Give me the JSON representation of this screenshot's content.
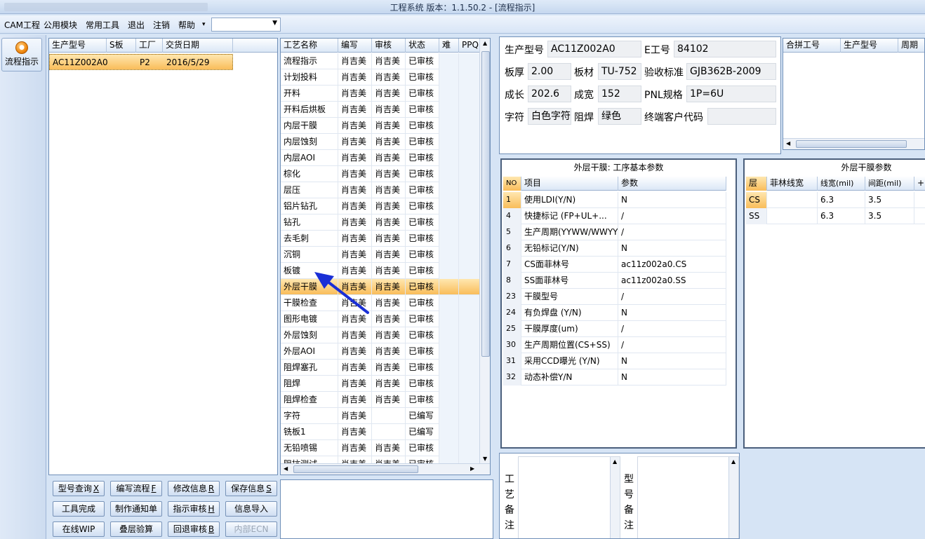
{
  "window": {
    "title": "工程系统   版本：1.1.50.2 - [流程指示]"
  },
  "menu": {
    "items": [
      "CAM工程",
      "公用模块",
      "常用工具",
      "退出",
      "注销",
      "帮助"
    ],
    "help_arrow": "▾",
    "combo_value": "",
    "combo_arrow": "▼"
  },
  "sidebar": {
    "flow_button": "流程指示"
  },
  "order_grid": {
    "headers": [
      "生产型号",
      "S板",
      "工厂",
      "交货日期"
    ],
    "rows": [
      [
        "AC11Z002A0",
        "",
        "P2",
        "2016/5/29"
      ]
    ]
  },
  "process_grid": {
    "headers": [
      "工艺名称",
      "编写",
      "审核",
      "状态",
      "难",
      "PPQI"
    ],
    "rows": [
      [
        "流程指示",
        "肖吉美",
        "肖吉美",
        "已审核"
      ],
      [
        "计划投料",
        "肖吉美",
        "肖吉美",
        "已审核"
      ],
      [
        "开料",
        "肖吉美",
        "肖吉美",
        "已审核"
      ],
      [
        "开料后烘板",
        "肖吉美",
        "肖吉美",
        "已审核"
      ],
      [
        "内层干膜",
        "肖吉美",
        "肖吉美",
        "已审核"
      ],
      [
        "内层蚀刻",
        "肖吉美",
        "肖吉美",
        "已审核"
      ],
      [
        "内层AOI",
        "肖吉美",
        "肖吉美",
        "已审核"
      ],
      [
        "棕化",
        "肖吉美",
        "肖吉美",
        "已审核"
      ],
      [
        "层压",
        "肖吉美",
        "肖吉美",
        "已审核"
      ],
      [
        "铝片钻孔",
        "肖吉美",
        "肖吉美",
        "已审核"
      ],
      [
        "钻孔",
        "肖吉美",
        "肖吉美",
        "已审核"
      ],
      [
        "去毛刺",
        "肖吉美",
        "肖吉美",
        "已审核"
      ],
      [
        "沉铜",
        "肖吉美",
        "肖吉美",
        "已审核"
      ],
      [
        "板镀",
        "肖吉美",
        "肖吉美",
        "已审核"
      ],
      [
        "外层干膜",
        "肖吉美",
        "肖吉美",
        "已审核"
      ],
      [
        "干膜检查",
        "肖吉美",
        "肖吉美",
        "已审核"
      ],
      [
        "图形电镀",
        "肖吉美",
        "肖吉美",
        "已审核"
      ],
      [
        "外层蚀刻",
        "肖吉美",
        "肖吉美",
        "已审核"
      ],
      [
        "外层AOI",
        "肖吉美",
        "肖吉美",
        "已审核"
      ],
      [
        "阻焊塞孔",
        "肖吉美",
        "肖吉美",
        "已审核"
      ],
      [
        "阻焊",
        "肖吉美",
        "肖吉美",
        "已审核"
      ],
      [
        "阻焊检查",
        "肖吉美",
        "肖吉美",
        "已审核"
      ],
      [
        "字符",
        "肖吉美",
        "",
        "已编写"
      ],
      [
        "铣板1",
        "肖吉美",
        "",
        "已编写"
      ],
      [
        "无铅喷锡",
        "肖吉美",
        "肖吉美",
        "已审核"
      ],
      [
        "阻抗测试",
        "肖吉美",
        "肖吉美",
        "已审核"
      ]
    ],
    "selected_index": 14
  },
  "buttons": [
    {
      "label": "型号查询",
      "key": "X"
    },
    {
      "label": "编写流程",
      "key": "F"
    },
    {
      "label": "修改信息",
      "key": "R"
    },
    {
      "label": "保存信息",
      "key": "S"
    },
    {
      "label": "工具完成",
      "key": ""
    },
    {
      "label": "制作通知单",
      "key": ""
    },
    {
      "label": "指示审核",
      "key": "H"
    },
    {
      "label": "信息导入",
      "key": ""
    },
    {
      "label": "在线WIP",
      "key": ""
    },
    {
      "label": "叠层验算",
      "key": ""
    },
    {
      "label": "回退审核",
      "key": "B"
    },
    {
      "label": "内部ECN",
      "key": ""
    }
  ],
  "info": {
    "model_label": "生产型号",
    "model": "AC11Z002A0",
    "e_label": "E工号",
    "e_no": "84102",
    "thick_label": "板厚",
    "thick": "2.00",
    "mat_label": "板材",
    "mat": "TU-752",
    "std_label": "验收标准",
    "std": "GJB362B-2009",
    "len_label": "成长",
    "len": "202.6",
    "wid_label": "成宽",
    "wid": "152",
    "pnl_label": "PNL规格",
    "pnl": "1P=6U",
    "char_label": "字符",
    "char": "白色字符",
    "mask_label": "阻焊",
    "mask": "绿色",
    "cust_label": "终端客户代码",
    "cust": ""
  },
  "merge_grid": {
    "headers": [
      "合拼工号",
      "生产型号",
      "周期"
    ]
  },
  "param_box": {
    "title": "外层干膜: 工序基本参数",
    "headers": [
      "NO",
      "项目",
      "参数"
    ],
    "rows": [
      [
        "1",
        "使用LDI(Y/N)",
        "N"
      ],
      [
        "4",
        "快捷标记 (FP+UL+...",
        "/"
      ],
      [
        "5",
        "生产周期(YYWW/WWYY)",
        "/"
      ],
      [
        "6",
        "无铅标记(Y/N)",
        "N"
      ],
      [
        "7",
        "CS面菲林号",
        "ac11z002a0.CS"
      ],
      [
        "8",
        "SS面菲林号",
        "ac11z002a0.SS"
      ],
      [
        "23",
        "干膜型号",
        "/"
      ],
      [
        "24",
        "有负焊盘 (Y/N)",
        "N"
      ],
      [
        "25",
        "干膜厚度(um)",
        "/"
      ],
      [
        "30",
        "生产周期位置(CS+SS)",
        "/"
      ],
      [
        "31",
        "采用CCD曝光 (Y/N)",
        "N"
      ],
      [
        "32",
        "动态补偿Y/N",
        "N"
      ]
    ]
  },
  "film_box": {
    "title": "外层干膜参数",
    "headers": [
      "层",
      "菲林线宽",
      "线宽(mil)",
      "间距(mil)",
      "+"
    ],
    "rows": [
      [
        "CS",
        "",
        "6.3",
        "3.5"
      ],
      [
        "SS",
        "",
        "6.3",
        "3.5"
      ]
    ]
  },
  "notes": {
    "process_label": [
      "工",
      "艺",
      "备",
      "注"
    ],
    "model_label": [
      "型",
      "号",
      "备",
      "注"
    ]
  }
}
